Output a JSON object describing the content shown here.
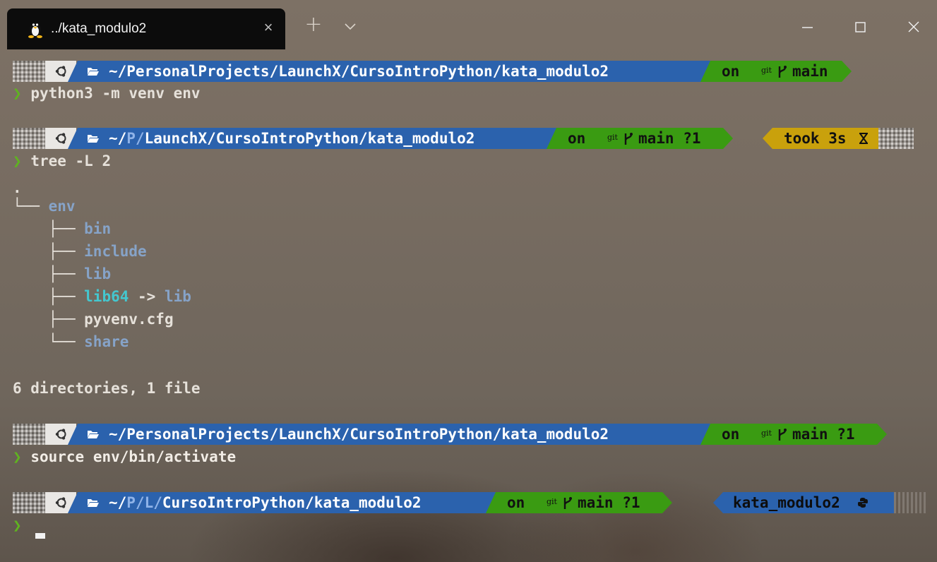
{
  "window": {
    "tab_title": "../kata_modulo2",
    "tab_icon": "linux-tux-icon",
    "tab_close": "×",
    "new_tab": "+",
    "minimize": "—",
    "maximize": "☐",
    "close": "✕"
  },
  "colors": {
    "path_segment": "#2b62ad",
    "git_segment": "#3a9b12",
    "took_segment": "#c9a10c",
    "prompt_arrow": "#5fb320",
    "dir_text": "#86a3c8",
    "link_text": "#44c7cf"
  },
  "terminal": {
    "prompt_arrow": "❯",
    "blocks": [
      {
        "path": "~/PersonalProjects/LaunchX/CursoIntroPython/kata_modulo2",
        "git_on": "on",
        "git_label": "git",
        "branch": "main",
        "command": "python3 -m venv env"
      },
      {
        "path_prefix": "~/",
        "path_abbrev": "P/",
        "path_rest": "LaunchX/CursoIntroPython/kata_modulo2",
        "git_on": "on",
        "git_label": "git",
        "branch": "main ?1",
        "took": "took 3s",
        "took_icon": "hourglass-icon",
        "command": "tree -L 2"
      },
      {
        "path": "~/PersonalProjects/LaunchX/CursoIntroPython/kata_modulo2",
        "git_on": "on",
        "git_label": "git",
        "branch": "main ?1",
        "command": "source env/bin/activate"
      },
      {
        "path_prefix": "~/",
        "path_abbrev": "P/L/",
        "path_rest": "CursoIntroPython/kata_modulo2",
        "git_on": "on",
        "git_label": "git",
        "branch": "main ?1",
        "venv": "kata_modulo2",
        "venv_icon": "python-icon",
        "command": ""
      }
    ],
    "tree_output": {
      "root": ".",
      "env": "env",
      "children": [
        "bin",
        "include",
        "lib"
      ],
      "link_name": "lib64",
      "link_arrow": "->",
      "link_target": "lib",
      "file": "pyvenv.cfg",
      "last": "share",
      "summary": "6 directories, 1 file"
    }
  }
}
